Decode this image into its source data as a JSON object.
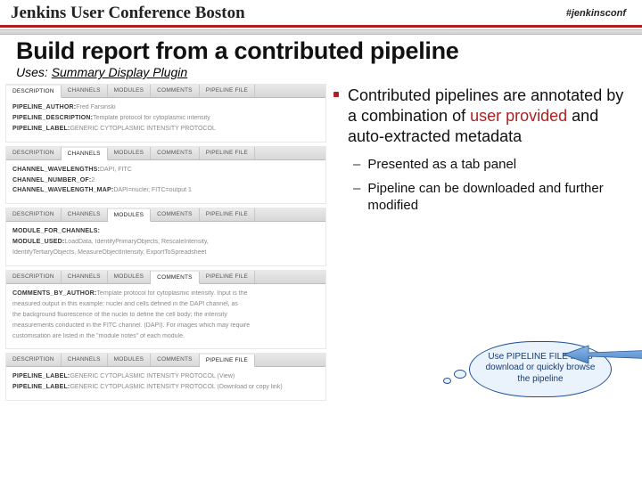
{
  "header": {
    "title": "Jenkins User Conference Boston",
    "hashtag": "#jenkinsconf"
  },
  "slide": {
    "title": "Build report from a contributed pipeline",
    "uses_prefix": "Uses: ",
    "uses_link": "Summary Display Plugin"
  },
  "panels": [
    {
      "tabs": [
        "DESCRIPTION",
        "CHANNELS",
        "MODULES",
        "COMMENTS",
        "PIPELINE FILE"
      ],
      "active": 0,
      "rows": [
        {
          "label": "PIPELINE_AUTHOR:",
          "val": "Fred Farsinski"
        },
        {
          "label": "PIPELINE_DESCRIPTION:",
          "val": "Template protocol for cytoplasmic intensity"
        },
        {
          "label": "PIPELINE_LABEL:",
          "val": "GENERIC CYTOPLASMIC INTENSITY PROTOCOL"
        }
      ]
    },
    {
      "tabs": [
        "DESCRIPTION",
        "CHANNELS",
        "MODULES",
        "COMMENTS",
        "PIPELINE FILE"
      ],
      "active": 1,
      "rows": [
        {
          "label": "CHANNEL_WAVELENGTHS:",
          "val": "DAPI, FITC"
        },
        {
          "label": "CHANNEL_NUMBER_OF:",
          "val": "2"
        },
        {
          "label": "CHANNEL_WAVELENGTH_MAP:",
          "val": "DAPI=nuclei; FITC=output 1"
        }
      ]
    },
    {
      "tabs": [
        "DESCRIPTION",
        "CHANNELS",
        "MODULES",
        "COMMENTS",
        "PIPELINE FILE"
      ],
      "active": 2,
      "rows": [
        {
          "label": "MODULE_FOR_CHANNELS:",
          "val": ""
        },
        {
          "label": "MODULE_USED:",
          "val": "LoadData, IdentifyPrimaryObjects, RescaleIntensity,"
        },
        {
          "label": "",
          "val": "IdentifyTertiaryObjects, MeasureObjectIntensity, ExportToSpreadsheet"
        }
      ]
    },
    {
      "tabs": [
        "DESCRIPTION",
        "CHANNELS",
        "MODULES",
        "COMMENTS",
        "PIPELINE FILE"
      ],
      "active": 3,
      "rows": [
        {
          "label": "COMMENTS_BY_AUTHOR:",
          "val": "Template protocol for cytoplasmic intensity. Input is the"
        },
        {
          "label": "",
          "val": "measured output in this example: nuclei and cells defined in the DAPI channel, as"
        },
        {
          "label": "",
          "val": "the background fluorescence of the nuclei to define the cell body; the intensity"
        },
        {
          "label": "",
          "val": "measurements conducted in the FITC channel. (DAPI). For images which may require"
        },
        {
          "label": "",
          "val": "customisation are listed in the \"module notes\" of each module."
        }
      ]
    },
    {
      "tabs": [
        "DESCRIPTION",
        "CHANNELS",
        "MODULES",
        "COMMENTS",
        "PIPELINE FILE"
      ],
      "active": 4,
      "rows": [
        {
          "label": "PIPELINE_LABEL:",
          "val": "GENERIC CYTOPLASMIC INTENSITY PROTOCOL (View)"
        },
        {
          "label": "PIPELINE_LABEL:",
          "val": "GENERIC CYTOPLASMIC INTENSITY PROTOCOL (Download or copy link)"
        }
      ]
    }
  ],
  "bullets": {
    "main_pre": "Contributed pipelines are annotated by a combination of ",
    "main_user": "user provided",
    "main_post": " and auto-extracted metadata",
    "sub1": "Presented as a tab panel",
    "sub2": "Pipeline can be downloaded and further modified"
  },
  "callout": "Use PIPELINE FILE tab to download or quickly browse the pipeline"
}
